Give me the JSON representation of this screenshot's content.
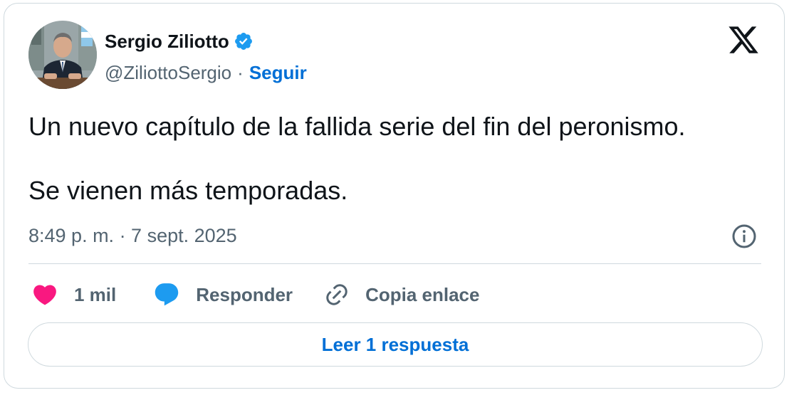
{
  "author": {
    "name": "Sergio Ziliotto",
    "handle": "@ZiliottoSergio",
    "separator": "·",
    "follow_label": "Seguir",
    "verified": true
  },
  "tweet": {
    "paragraphs": [
      "Un nuevo capítulo de la fallida serie del fin del peronismo.",
      "Se vienen más temporadas."
    ],
    "timestamp": "8:49 p. m. · 7 sept. 2025"
  },
  "actions": {
    "like_count": "1 mil",
    "reply_label": "Responder",
    "copy_label": "Copia enlace"
  },
  "read_replies_label": "Leer 1 respuesta",
  "icons": {
    "brand": "x-logo-icon",
    "verified": "verified-badge-icon",
    "info": "info-icon",
    "like": "heart-icon",
    "reply": "speech-bubble-icon",
    "copy": "link-icon"
  },
  "colors": {
    "text": "#0f1419",
    "secondary": "#536471",
    "link": "#006fd6",
    "verified": "#1d9bf0",
    "like": "#f91880",
    "reply": "#1d9bf0",
    "border": "#cfd9de"
  }
}
